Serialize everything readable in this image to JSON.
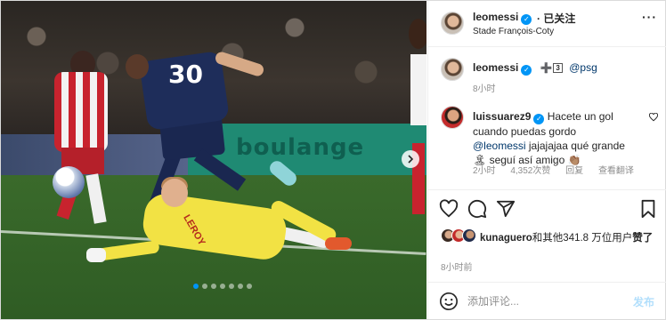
{
  "post": {
    "username": "leomessi",
    "follow_status": "· 已关注",
    "location": "Stade François-Coty",
    "more_label": "···"
  },
  "caption": {
    "username": "leomessi",
    "emoji_text": "➕",
    "emoji_box": "3",
    "mention": "@psg",
    "time": "8小时"
  },
  "comment": {
    "username": "luissuarez9",
    "text_before": "Hacete un gol cuando puedas gordo ",
    "mention": "@leomessi",
    "text_after": " jajajajaa qué grande🏝 seguí así amigo 👏🏽",
    "time": "2小时",
    "likes": "4,352次赞",
    "reply": "回复",
    "view_translation": "查看翻译"
  },
  "likes": {
    "user": "kunaguero",
    "text": "和其他341.8 万位用户",
    "suffix": "赞了"
  },
  "post_time": "8小时前",
  "comment_box": {
    "placeholder": "添加评论...",
    "post_label": "发布"
  },
  "photo": {
    "banner_text": "boulange",
    "gk_name": "LEROY",
    "jersey_number": "30",
    "carousel_count": 7,
    "carousel_active": 0
  },
  "colors": {
    "accent": "#0095f6",
    "post_disabled": "#b2dffc",
    "mention": "#00376b",
    "muted": "#8e8e8e"
  }
}
